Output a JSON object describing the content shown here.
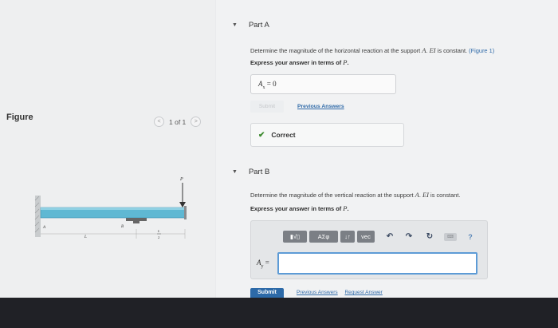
{
  "figure": {
    "label": "Figure",
    "pager": {
      "prev": "<",
      "count": "1 of 1",
      "next": ">"
    },
    "beam": {
      "load_label": "P",
      "point_a": "A",
      "point_b": "B",
      "span_label": "L",
      "half_span_num": "L",
      "half_span_den": "2"
    }
  },
  "part_a": {
    "caret": "▼",
    "title": "Part A",
    "prompt_pre": "Determine the magnitude of the horizontal reaction at the support ",
    "prompt_support": "A",
    "prompt_mid": ". ",
    "prompt_ei": "EI",
    "prompt_post": " is constant.",
    "prompt_link": "(Figure 1)",
    "instruction_pre": "Express your answer in terms of ",
    "instruction_var": "P",
    "instruction_post": ".",
    "answer_var": "A",
    "answer_sub": "x",
    "answer_value": "= 0",
    "submit_label": "Submit",
    "previous_answers": "Previous Answers",
    "feedback_icon": "check-icon",
    "feedback_text": "Correct"
  },
  "part_b": {
    "caret": "▼",
    "title": "Part B",
    "prompt_pre": "Determine the magnitude of the vertical reaction at the support ",
    "prompt_support": "A",
    "prompt_mid": ". ",
    "prompt_ei": "EI",
    "prompt_post": " is constant.",
    "instruction_pre": "Express your answer in terms of ",
    "instruction_var": "P",
    "instruction_post": ".",
    "toolbar": {
      "templates": "▮√▯",
      "greek": "ΑΣφ",
      "arrows": "↓↑",
      "vec": "vec",
      "undo": "↶",
      "redo": "↷",
      "reset": "↻",
      "keyboard": "⌨",
      "help": "?"
    },
    "answer_var": "A",
    "answer_sub": "y",
    "answer_eq": "=",
    "input_value": "",
    "submit_label": "Submit",
    "links": [
      "Previous Answers",
      "Request Answer"
    ]
  },
  "colors": {
    "accent": "#2d6aa8",
    "input_border": "#5d9bd6",
    "success": "#3c8a2e",
    "beam": "#5fb8d3"
  }
}
